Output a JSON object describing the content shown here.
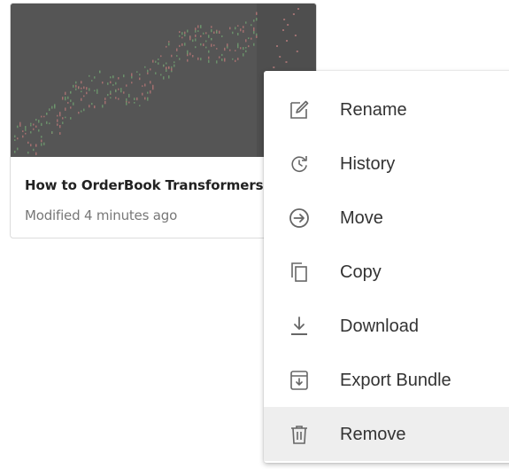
{
  "card": {
    "title": "How to OrderBook Transformers",
    "subtitle": "Modified 4 minutes ago"
  },
  "menu": {
    "items": [
      {
        "label": "Rename",
        "icon": "edit-icon"
      },
      {
        "label": "History",
        "icon": "history-icon"
      },
      {
        "label": "Move",
        "icon": "move-icon"
      },
      {
        "label": "Copy",
        "icon": "copy-icon"
      },
      {
        "label": "Download",
        "icon": "download-icon"
      },
      {
        "label": "Export Bundle",
        "icon": "export-bundle-icon"
      },
      {
        "label": "Remove",
        "icon": "trash-icon",
        "highlighted": true
      }
    ]
  },
  "colors": {
    "thumbnail_bg": "#555555",
    "menu_icon": "#666666",
    "highlight_bg": "#eeeeee"
  }
}
